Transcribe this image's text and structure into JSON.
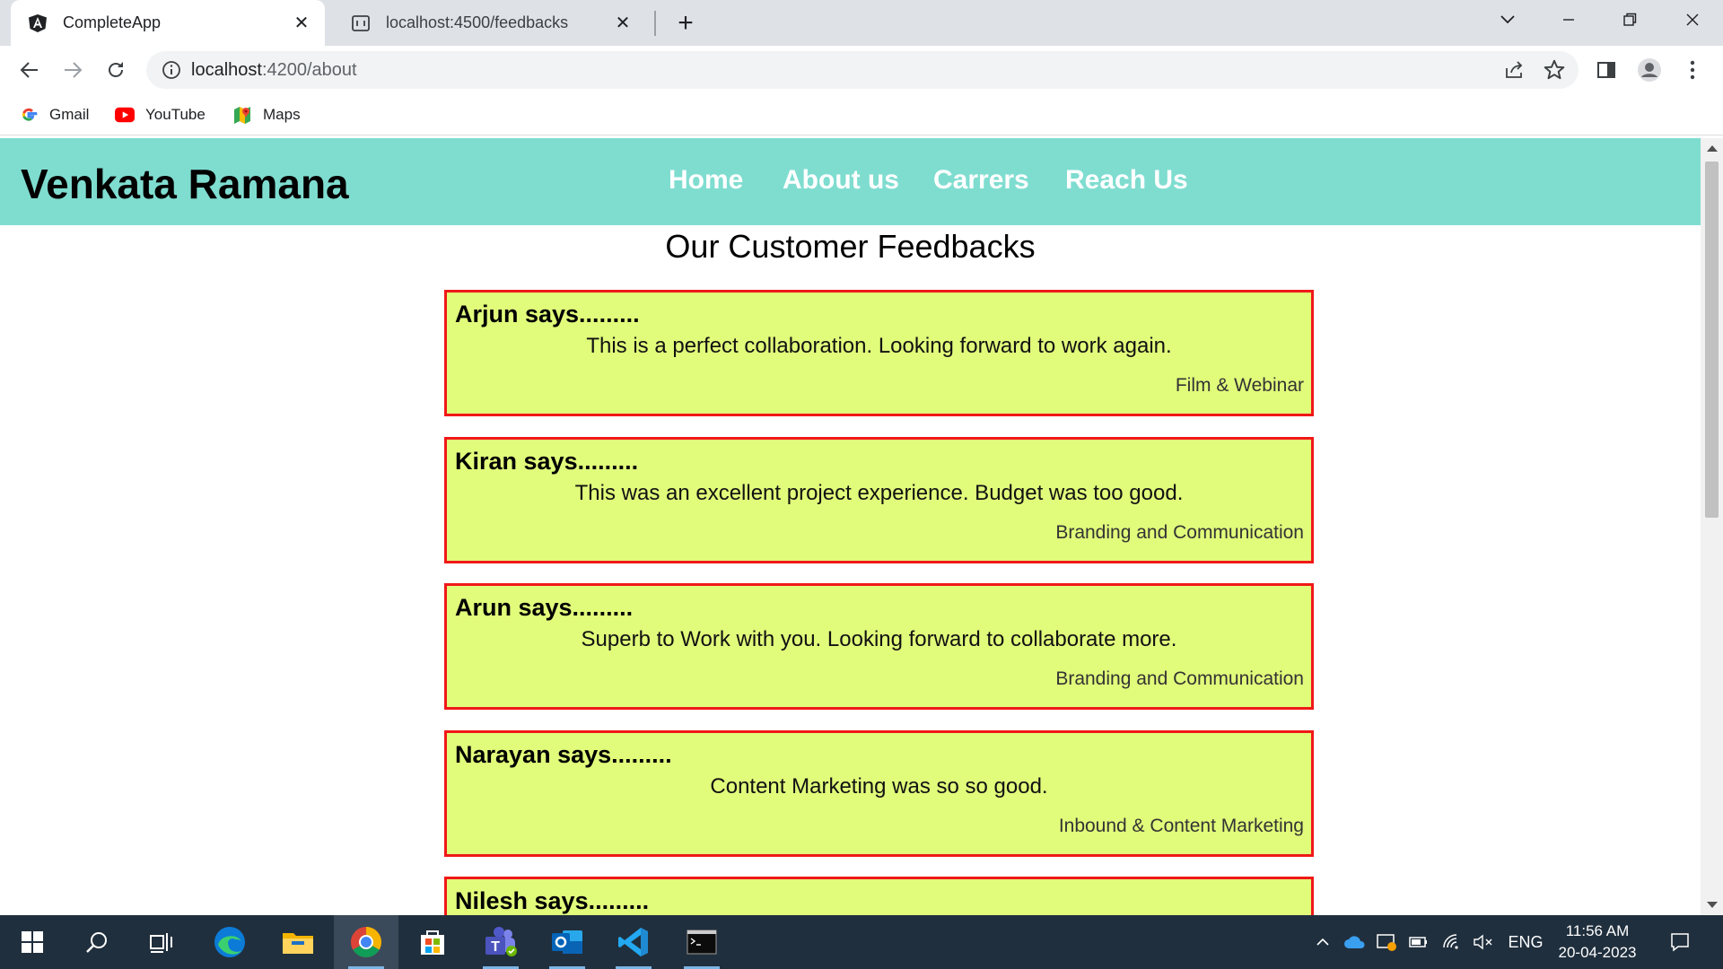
{
  "browser": {
    "tabs": [
      {
        "title": "CompleteApp",
        "icon": "angular-icon",
        "active": true
      },
      {
        "title": "localhost:4500/feedbacks",
        "icon": "page-icon",
        "active": false
      }
    ],
    "address": {
      "host": "localhost",
      "path": ":4200/about"
    },
    "bookmarks": [
      {
        "label": "Gmail",
        "icon": "google-icon"
      },
      {
        "label": "YouTube",
        "icon": "youtube-icon"
      },
      {
        "label": "Maps",
        "icon": "maps-icon"
      }
    ]
  },
  "site": {
    "brand": "Venkata Ramana",
    "nav": [
      "Home",
      "About us",
      "Carrers",
      "Reach Us"
    ],
    "heading": "Our Customer Feedbacks",
    "feedbacks": [
      {
        "who": "Arjun says.........",
        "message": "This is a perfect collaboration. Looking forward to work again.",
        "category": "Film & Webinar"
      },
      {
        "who": "Kiran says.........",
        "message": "This was an excellent project experience. Budget was too good.",
        "category": "Branding and Communication"
      },
      {
        "who": "Arun says.........",
        "message": "Superb to Work with you. Looking forward to collaborate more.",
        "category": "Branding and Communication"
      },
      {
        "who": "Narayan says.........",
        "message": "Content Marketing was so so good.",
        "category": "Inbound & Content Marketing"
      },
      {
        "who": "Nilesh says.........",
        "message": "",
        "category": ""
      }
    ],
    "colors": {
      "navbar": "#7fddd0",
      "card_bg": "#e1fb7b",
      "card_border": "#f01818"
    }
  },
  "taskbar": {
    "tray_language": "ENG",
    "time": "11:56 AM",
    "date": "20-04-2023"
  }
}
